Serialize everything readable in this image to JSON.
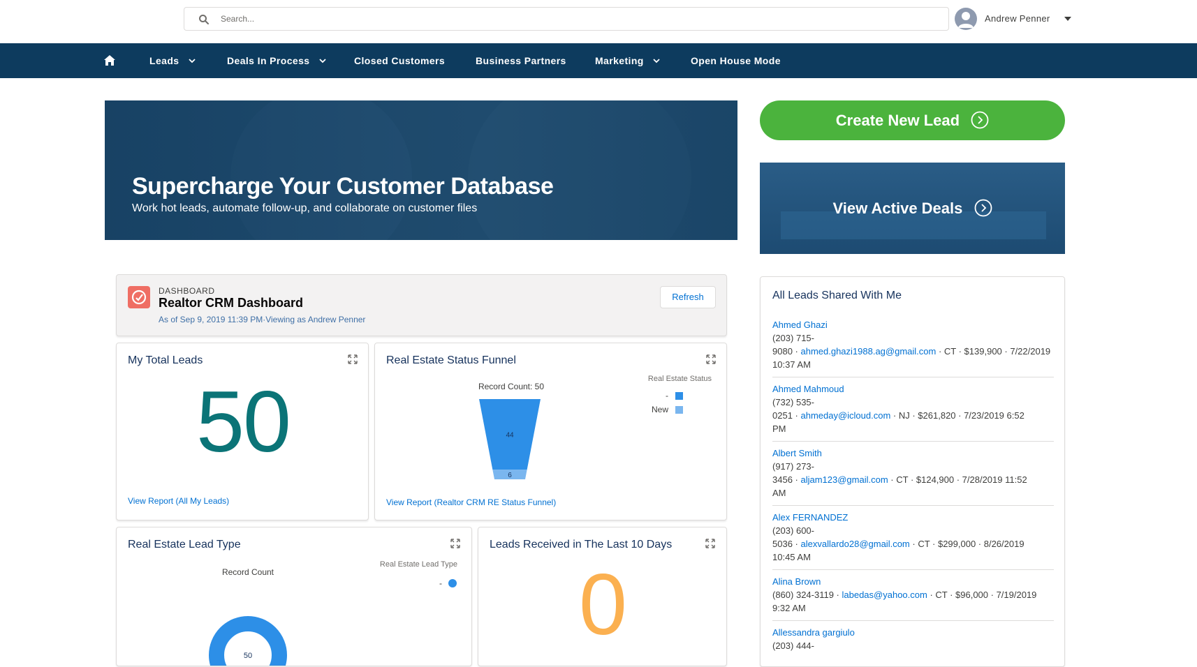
{
  "search": {
    "placeholder": "Search..."
  },
  "user": {
    "name": "Andrew Penner"
  },
  "nav": {
    "items": [
      {
        "label": "Leads",
        "dropdown": true
      },
      {
        "label": "Deals In Process",
        "dropdown": true
      },
      {
        "label": "Closed Customers",
        "dropdown": false
      },
      {
        "label": "Business Partners",
        "dropdown": false
      },
      {
        "label": "Marketing",
        "dropdown": true
      },
      {
        "label": "Open House Mode",
        "dropdown": false
      }
    ]
  },
  "hero": {
    "title": "Supercharge Your Customer Database",
    "subtitle": "Work hot leads, automate follow-up, and collaborate on customer files"
  },
  "actions": {
    "create_lead": "Create New Lead",
    "view_deals": "View Active Deals"
  },
  "dashboard": {
    "eyebrow": "DASHBOARD",
    "title": "Realtor CRM Dashboard",
    "meta": "As of Sep 9, 2019 11:39 PM·Viewing as Andrew Penner",
    "refresh": "Refresh"
  },
  "widgets": {
    "total_leads": {
      "title": "My Total Leads",
      "value": "50",
      "link": "View Report (All My Leads)"
    },
    "status_funnel": {
      "title": "Real Estate Status Funnel",
      "link": "View Report (Realtor CRM RE Status Funnel)"
    },
    "lead_type": {
      "title": "Real Estate Lead Type"
    },
    "last_10_days": {
      "title": "Leads Received in The Last 10 Days",
      "value": "0"
    }
  },
  "chart_data": [
    {
      "type": "funnel",
      "title": "Real Estate Status Funnel",
      "header": "Record Count: 50",
      "legend_title": "Real Estate Status",
      "legend_position": "top-right",
      "categories": [
        "-",
        "New"
      ],
      "values": [
        44,
        6
      ],
      "colors": [
        "#2d8fe7",
        "#7ab6ef"
      ]
    },
    {
      "type": "donut",
      "title": "Real Estate Lead Type",
      "header": "Record Count",
      "legend_title": "Real Estate Lead Type",
      "legend_position": "top-right",
      "categories": [
        "-"
      ],
      "values": [
        50
      ],
      "center_label": "50",
      "colors": [
        "#2d8fe7"
      ]
    }
  ],
  "leads_shared": {
    "title": "All Leads Shared With Me",
    "items": [
      {
        "name": "Ahmed Ghazi",
        "phone1": "(203) 715-",
        "phone2": "9080",
        "email": "ahmed.ghazi1988.ag@gmail.com",
        "rest": " · CT · $139,900 · 7/22/2019",
        "rest2": "10:37 AM"
      },
      {
        "name": "Ahmed Mahmoud",
        "phone1": "(732) 535-",
        "phone2": "0251",
        "email": "ahmeday@icloud.com",
        "rest": " · NJ · $261,820 · 7/23/2019 6:52",
        "rest2": "PM"
      },
      {
        "name": "Albert Smith",
        "phone1": "(917) 273-",
        "phone2": "3456",
        "email": "aljam123@gmail.com",
        "rest": " · CT · $124,900 · 7/28/2019 11:52",
        "rest2": "AM"
      },
      {
        "name": "Alex FERNANDEZ",
        "phone1": "(203) 600-",
        "phone2": "5036",
        "email": "alexvallardo28@gmail.com",
        "rest": " · CT · $299,000 · 8/26/2019",
        "rest2": "10:45 AM"
      },
      {
        "name": "Alina Brown",
        "phone1": "(860) 324-3119",
        "phone2": "",
        "email": "labedas@yahoo.com",
        "rest": " · CT · $96,000 · 7/19/2019",
        "rest2": "9:32 AM"
      },
      {
        "name": "Allessandra gargiulo",
        "phone1": "(203) 444-",
        "phone2": "",
        "email": "",
        "rest": "",
        "rest2": ""
      }
    ]
  },
  "colors": {
    "nav_bg": "#0d3b5e",
    "create_green": "#4bb33d",
    "total_teal": "#0b7477",
    "zero_orange": "#fbb050",
    "link_blue": "#0070d2"
  },
  "icons": {
    "search": "search-icon",
    "home": "home-icon",
    "expand": "expand-icon",
    "arrow": "circle-arrow-right-icon"
  }
}
